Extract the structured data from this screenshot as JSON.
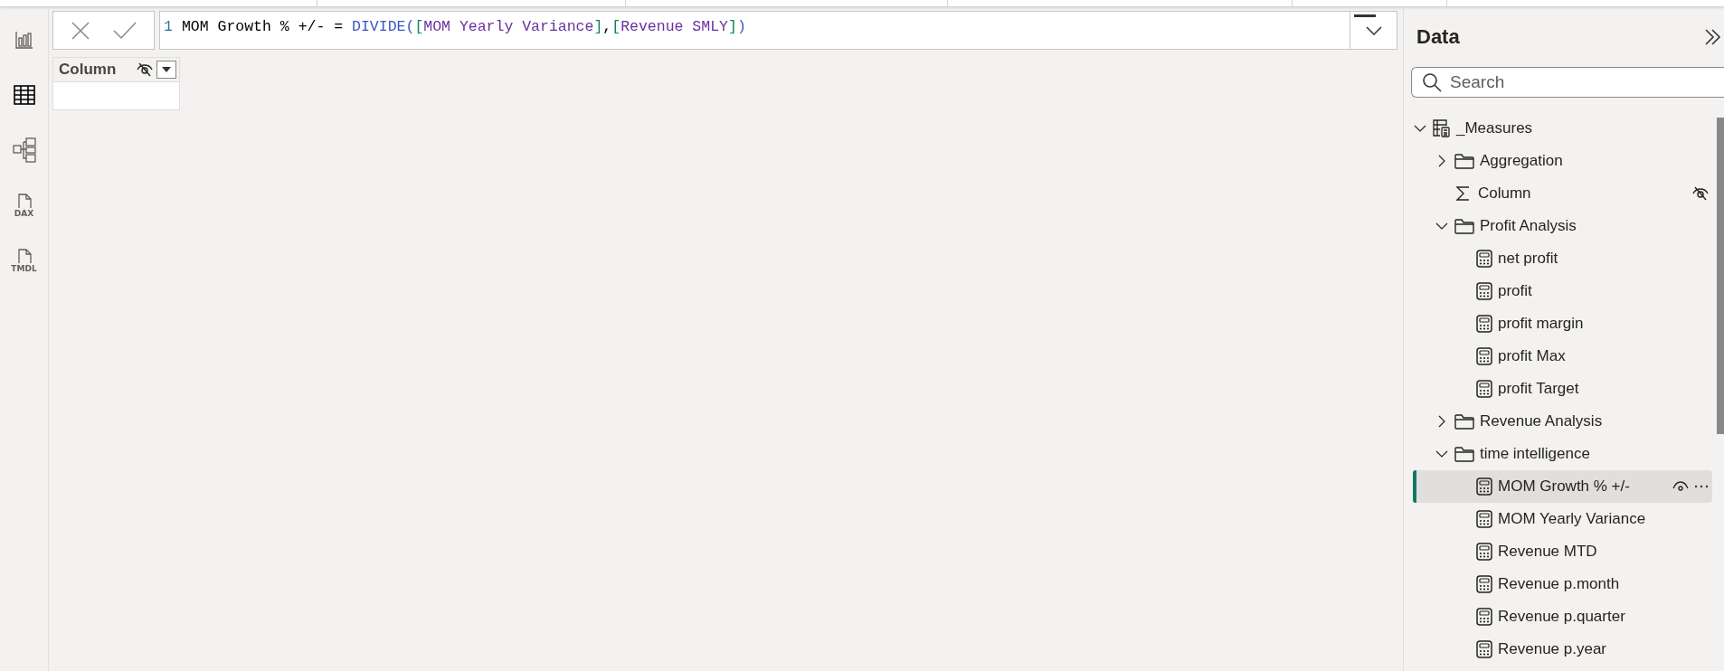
{
  "rail": [
    {
      "kind": "report",
      "selected": false
    },
    {
      "kind": "table",
      "selected": true
    },
    {
      "kind": "model",
      "selected": false
    },
    {
      "kind": "doc",
      "label": "DAX",
      "selected": false
    },
    {
      "kind": "doc",
      "label": "TMDL",
      "selected": false
    }
  ],
  "formula_bar": {
    "line_number": "1",
    "tokens": [
      {
        "text": "MOM Growth % +/- = ",
        "kind": "plain"
      },
      {
        "text": "DIVIDE",
        "kind": "function"
      },
      {
        "text": "(",
        "kind": "paren"
      },
      {
        "text": "[",
        "kind": "bracket"
      },
      {
        "text": "MOM Yearly Variance",
        "kind": "measure"
      },
      {
        "text": "]",
        "kind": "bracket"
      },
      {
        "text": ",",
        "kind": "plain"
      },
      {
        "text": "[",
        "kind": "bracket"
      },
      {
        "text": "Revenue SMLY",
        "kind": "measure"
      },
      {
        "text": "]",
        "kind": "bracket"
      },
      {
        "text": ")",
        "kind": "paren"
      }
    ]
  },
  "table": {
    "column": {
      "name": "Column",
      "hidden": true
    }
  },
  "data_pane": {
    "title": "Data",
    "search": {
      "placeholder": "Search"
    },
    "tree": [
      {
        "label": "_Measures",
        "kind": "table",
        "expanded": true,
        "selected": false,
        "children": [
          {
            "label": "Aggregation",
            "kind": "folder",
            "expanded": false,
            "selected": false
          },
          {
            "label": "Column",
            "kind": "column",
            "hidden": true,
            "selected": false
          },
          {
            "label": "Profit Analysis",
            "kind": "folder",
            "expanded": true,
            "selected": false,
            "children": [
              {
                "label": "net profit",
                "kind": "measure",
                "selected": false
              },
              {
                "label": "profit",
                "kind": "measure",
                "selected": false
              },
              {
                "label": "profit margin",
                "kind": "measure",
                "selected": false
              },
              {
                "label": "profit Max",
                "kind": "measure",
                "selected": false
              },
              {
                "label": "profit Target",
                "kind": "measure",
                "selected": false
              }
            ]
          },
          {
            "label": "Revenue Analysis",
            "kind": "folder",
            "expanded": false,
            "selected": false
          },
          {
            "label": "time intelligence",
            "kind": "folder",
            "expanded": true,
            "selected": false,
            "children": [
              {
                "label": "MOM Growth % +/-",
                "kind": "measure",
                "selected": true
              },
              {
                "label": "MOM Yearly Variance",
                "kind": "measure",
                "selected": false
              },
              {
                "label": "Revenue MTD",
                "kind": "measure",
                "selected": false
              },
              {
                "label": "Revenue p.month",
                "kind": "measure",
                "selected": false
              },
              {
                "label": "Revenue p.quarter",
                "kind": "measure",
                "selected": false
              },
              {
                "label": "Revenue p.year",
                "kind": "measure",
                "selected": false
              }
            ]
          }
        ]
      }
    ]
  }
}
